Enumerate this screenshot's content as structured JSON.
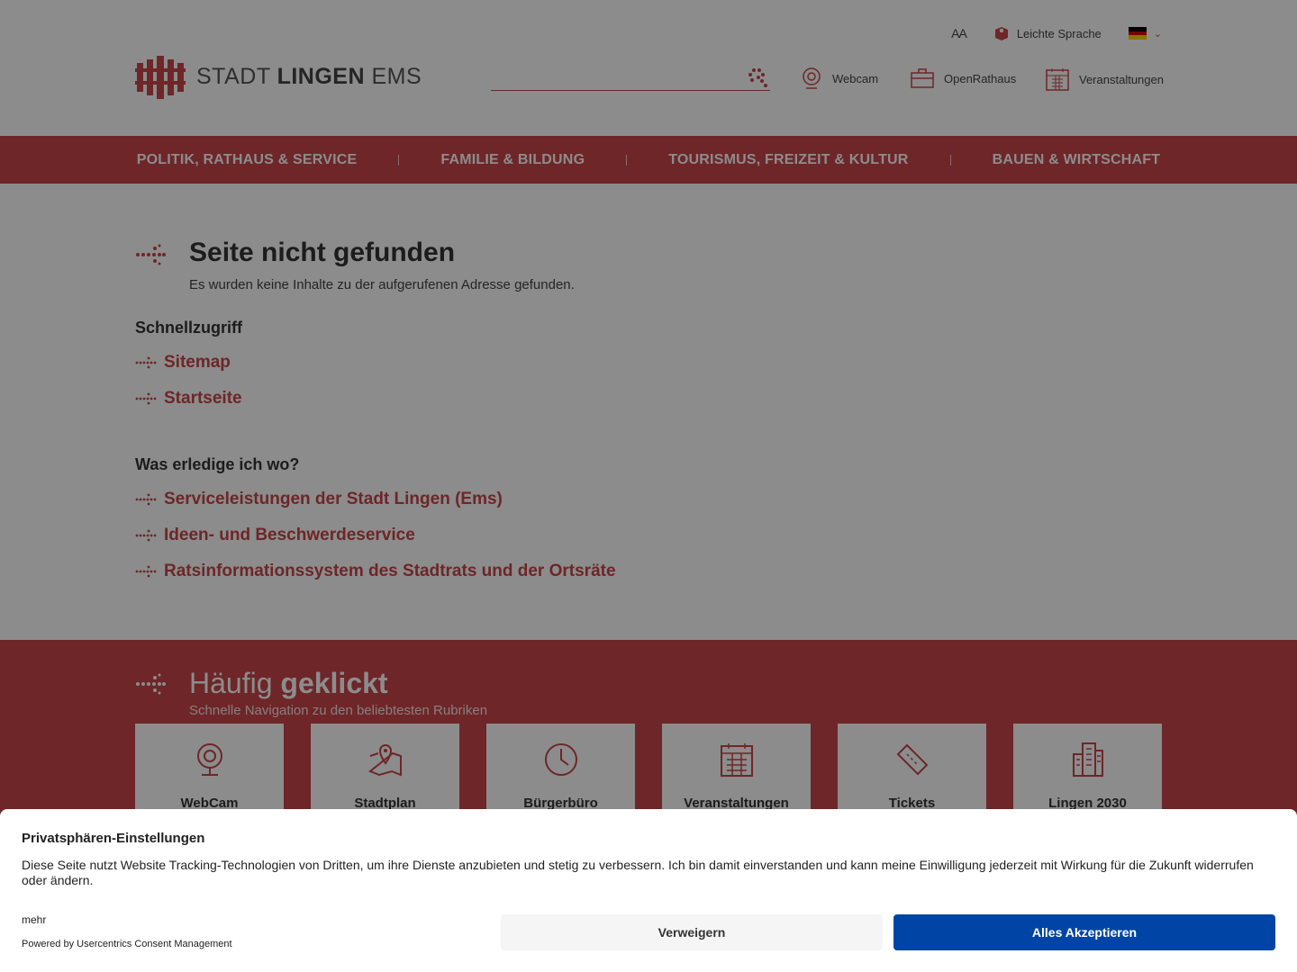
{
  "header": {
    "font_size_toggle": "AA",
    "easy_language": "Leichte Sprache",
    "language_flag": "de-flag",
    "logo": {
      "word1": "STADT",
      "word2": "LINGEN",
      "word3": "EMS"
    },
    "search_placeholder": "",
    "quick_links": [
      {
        "label": "Webcam",
        "icon": "webcam-icon"
      },
      {
        "label": "OpenRathaus",
        "icon": "briefcase-icon"
      },
      {
        "label": "Veranstaltungen",
        "icon": "calendar-icon"
      }
    ]
  },
  "nav": {
    "items": [
      "POLITIK, RATHAUS & SERVICE",
      "FAMILIE & BILDUNG",
      "TOURISMUS, FREIZEIT & KULTUR",
      "BAUEN & WIRTSCHAFT"
    ]
  },
  "main": {
    "title": "Seite nicht gefunden",
    "subtitle": "Es wurden keine Inhalte zu der aufgerufenen Adresse gefunden.",
    "section1_title": "Schnellzugriff",
    "section1_links": [
      "Sitemap",
      "Startseite"
    ],
    "section2_title": "Was erledige ich wo?",
    "section2_links": [
      "Serviceleistungen der Stadt Lingen (Ems)",
      "Ideen- und Beschwerdeservice",
      "Ratsinformationssystem des Stadtrats und der Ortsräte"
    ]
  },
  "haeufig": {
    "title_light": "Häufig",
    "title_bold": "geklickt",
    "subtitle": "Schnelle Navigation zu den beliebtesten Rubriken",
    "tiles": [
      "WebCam",
      "Stadtplan",
      "Bürgerbüro",
      "Veranstaltungen",
      "Tickets",
      "Lingen 2030"
    ]
  },
  "consent": {
    "title": "Privatsphären-Einstellungen",
    "text": "Diese Seite nutzt Website Tracking-Technologien von Dritten, um ihre Dienste anzubieten und stetig zu verbessern. Ich bin damit einverstanden und kann meine Einwilligung jederzeit mit Wirkung für die Zukunft widerrufen oder ändern.",
    "more": "mehr",
    "powered": "Powered by Usercentrics Consent Management",
    "deny": "Verweigern",
    "accept": "Alles Akzeptieren"
  },
  "colors": {
    "brand_red": "#c8454a",
    "accept_blue": "#0045a5"
  }
}
